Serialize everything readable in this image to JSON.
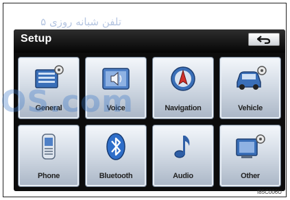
{
  "screen": {
    "title": "Setup",
    "back_icon": "back-arrow-icon"
  },
  "tiles": [
    {
      "label": "General",
      "icon": "general-settings-icon"
    },
    {
      "label": "Voice",
      "icon": "voice-icon"
    },
    {
      "label": "Navigation",
      "icon": "navigation-icon"
    },
    {
      "label": "Vehicle",
      "icon": "vehicle-icon"
    },
    {
      "label": "Phone",
      "icon": "phone-icon"
    },
    {
      "label": "Bluetooth",
      "icon": "bluetooth-icon"
    },
    {
      "label": "Audio",
      "icon": "audio-icon"
    },
    {
      "label": "Other",
      "icon": "other-settings-icon"
    }
  ],
  "watermark": {
    "persian": "تلفن شبانه روزی ۵",
    "latin": "OS.com"
  },
  "figure_code": "I85C006U"
}
